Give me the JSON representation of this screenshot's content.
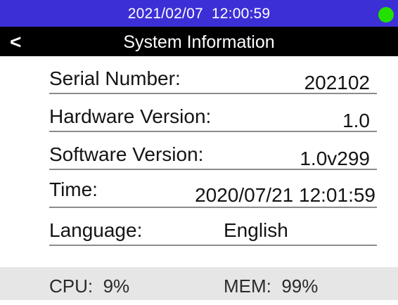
{
  "status_bar": {
    "datetime": "2021/02/07  12:00:59",
    "indicator_color": "#22e000",
    "background_color": "#3c2fd6"
  },
  "header": {
    "back_label": "<",
    "title": "System Information"
  },
  "info": {
    "serial": {
      "label": "Serial Number:",
      "value": "202102"
    },
    "hardware": {
      "label": "Hardware Version:",
      "value": "1.0"
    },
    "software": {
      "label": "Software Version:",
      "value": "1.0v299"
    },
    "time": {
      "label": "Time:",
      "value": "2020/07/21 12:01:59"
    },
    "language": {
      "label": "Language:",
      "value": "English"
    }
  },
  "footer": {
    "cpu": "CPU:  9%",
    "mem": "MEM:  99%"
  }
}
